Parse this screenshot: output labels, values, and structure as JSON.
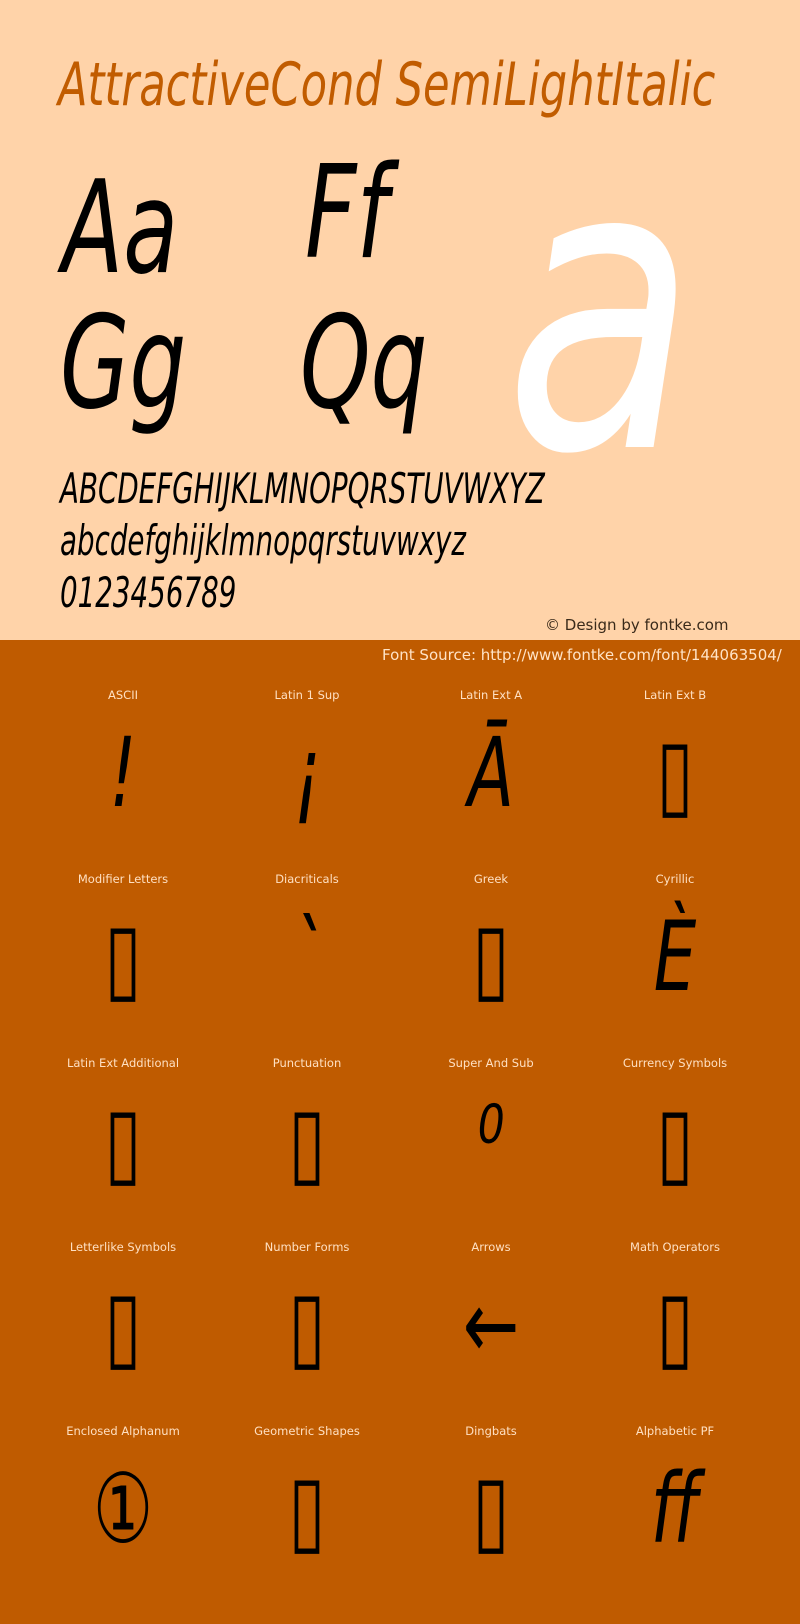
{
  "title": "AttractiveCond SemiLightItalic",
  "specimen": {
    "pairs": [
      "Aa",
      "Ff",
      "Gg",
      "Qq"
    ],
    "hero_glyph": "a",
    "uppercase": "ABCDEFGHIJKLMNOPQRSTUVWXYZ",
    "lowercase": "abcdefghijklmnopqrstuvwxyz",
    "digits": "0123456789"
  },
  "credit": "© Design by fontke.com",
  "source": "Font Source: http://www.fontke.com/font/144063504/",
  "colors": {
    "peach": "#FFD3A9",
    "orange": "#BF5B00",
    "title": "#C15C00",
    "hero": "#FFFFFF"
  },
  "blocks": [
    {
      "label": "ASCII",
      "glyph": "!"
    },
    {
      "label": "Latin 1 Sup",
      "glyph": "¡"
    },
    {
      "label": "Latin Ext A",
      "glyph": "Ā"
    },
    {
      "label": "Latin Ext B",
      "glyph": "▯"
    },
    {
      "label": "Modifier Letters",
      "glyph": "▯"
    },
    {
      "label": "Diacriticals",
      "glyph": "`"
    },
    {
      "label": "Greek",
      "glyph": "▯"
    },
    {
      "label": "Cyrillic",
      "glyph": "È"
    },
    {
      "label": "Latin Ext Additional",
      "glyph": "▯"
    },
    {
      "label": "Punctuation",
      "glyph": "▯"
    },
    {
      "label": "Super And Sub",
      "glyph": "⁰"
    },
    {
      "label": "Currency Symbols",
      "glyph": "▯"
    },
    {
      "label": "Letterlike Symbols",
      "glyph": "▯"
    },
    {
      "label": "Number Forms",
      "glyph": "▯"
    },
    {
      "label": "Arrows",
      "glyph": "←"
    },
    {
      "label": "Math Operators",
      "glyph": "▯"
    },
    {
      "label": "Enclosed Alphanum",
      "glyph": "①"
    },
    {
      "label": "Geometric Shapes",
      "glyph": "▯"
    },
    {
      "label": "Dingbats",
      "glyph": "▯"
    },
    {
      "label": "Alphabetic PF",
      "glyph": "ﬀ"
    }
  ]
}
